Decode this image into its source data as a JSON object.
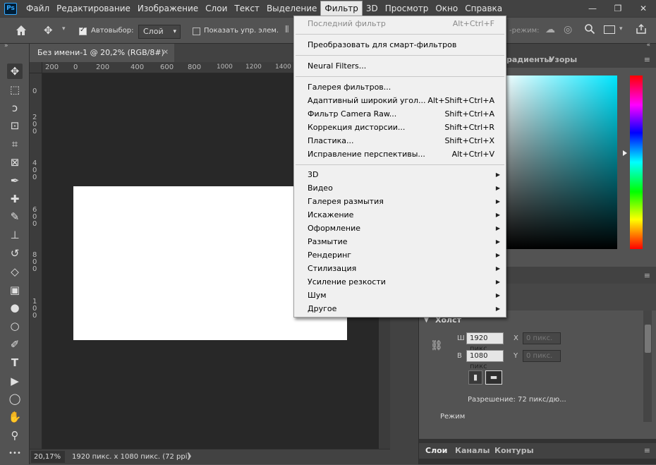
{
  "app": {
    "logo": "Ps"
  },
  "menubar": {
    "items": [
      "Файл",
      "Редактирование",
      "Изображение",
      "Слои",
      "Текст",
      "Выделение",
      "Фильтр",
      "3D",
      "Просмотр",
      "Окно",
      "Справка"
    ],
    "active": "Фильтр"
  },
  "window_buttons": {
    "minimize": "—",
    "restore": "❐",
    "close": "✕"
  },
  "options_bar": {
    "auto_select_label": "Автовыбор:",
    "auto_select_checked": true,
    "auto_select_target": "Слой",
    "show_transform_label": "Показать упр. элем.",
    "show_transform_checked": false,
    "mode_label": "-режим:"
  },
  "document": {
    "tab_title": "Без имени-1 @ 20,2% (RGB/8#)",
    "close_glyph": "✕",
    "zoom": "20,17%",
    "size_info": "1920 пикс. x 1080 пикс. (72 ppi)",
    "status_arrow": "❯",
    "canvas_color": "#ffffff"
  },
  "ruler": {
    "top_labels": [
      "200",
      "0",
      "200",
      "400",
      "600",
      "800",
      "1000",
      "1200",
      "1400"
    ],
    "left_labels": [
      "0",
      "2",
      "0",
      "0",
      "4",
      "0",
      "0",
      "6",
      "0",
      "0",
      "8",
      "0",
      "0",
      "1",
      "0",
      "0"
    ]
  },
  "toolbar": {
    "tools": [
      {
        "name": "move-tool",
        "glyph": "✥",
        "selected": true
      },
      {
        "name": "marquee-tool",
        "glyph": "⬚"
      },
      {
        "name": "lasso-tool",
        "glyph": "ↄ"
      },
      {
        "name": "object-select-tool",
        "glyph": "⊡"
      },
      {
        "name": "crop-tool",
        "glyph": "⌗"
      },
      {
        "name": "frame-tool",
        "glyph": "⊠"
      },
      {
        "name": "eyedropper-tool",
        "glyph": "✒"
      },
      {
        "name": "healing-tool",
        "glyph": "✚"
      },
      {
        "name": "brush-tool",
        "glyph": "✎"
      },
      {
        "name": "stamp-tool",
        "glyph": "⊥"
      },
      {
        "name": "history-brush-tool",
        "glyph": "↺"
      },
      {
        "name": "eraser-tool",
        "glyph": "◇"
      },
      {
        "name": "gradient-tool",
        "glyph": "▣"
      },
      {
        "name": "blur-tool",
        "glyph": "●"
      },
      {
        "name": "dodge-tool",
        "glyph": "○"
      },
      {
        "name": "pen-tool",
        "glyph": "✐"
      },
      {
        "name": "type-tool",
        "glyph": "T"
      },
      {
        "name": "path-select-tool",
        "glyph": "▶"
      },
      {
        "name": "shape-tool",
        "glyph": "◯"
      },
      {
        "name": "hand-tool",
        "glyph": "✋"
      },
      {
        "name": "zoom-tool",
        "glyph": "⚲"
      },
      {
        "name": "more-tools",
        "glyph": "•••"
      }
    ]
  },
  "panels": {
    "color_tabs": [
      "радиенты",
      "Узоры"
    ],
    "properties": {
      "section": "Холст",
      "w_label": "Ш",
      "w_value": "1920 пикс",
      "h_label": "В",
      "h_value": "1080 пикс",
      "x_label": "X",
      "x_value": "0 пикс.",
      "y_label": "Y",
      "y_value": "0 пикс.",
      "resolution": "Разрешение: 72 пикс/дю...",
      "mode_label": "Режим"
    },
    "layers_tabs": [
      "Слои",
      "Каналы",
      "Контуры"
    ]
  },
  "filter_menu": {
    "last_filter": {
      "label": "Последний фильтр",
      "shortcut": "Alt+Ctrl+F",
      "disabled": true
    },
    "smart_filters": {
      "label": "Преобразовать для смарт-фильтров"
    },
    "neural": {
      "label": "Neural Filters..."
    },
    "gallery_items": [
      {
        "label": "Галерея фильтров...",
        "shortcut": ""
      },
      {
        "label": "Адаптивный широкий угол...",
        "shortcut": "Alt+Shift+Ctrl+A"
      },
      {
        "label": "Фильтр Camera Raw...",
        "shortcut": "Shift+Ctrl+A"
      },
      {
        "label": "Коррекция дисторсии...",
        "shortcut": "Shift+Ctrl+R"
      },
      {
        "label": "Пластика...",
        "shortcut": "Shift+Ctrl+X"
      },
      {
        "label": "Исправление перспективы...",
        "shortcut": "Alt+Ctrl+V"
      }
    ],
    "submenus": [
      "3D",
      "Видео",
      "Галерея размытия",
      "Искажение",
      "Оформление",
      "Размытие",
      "Рендеринг",
      "Стилизация",
      "Усиление резкости",
      "Шум",
      "Другое"
    ],
    "submenu_arrow": "▶"
  },
  "colors": {
    "menu_bg": "#f0f0f0",
    "ui_dark": "#424242",
    "ui_mid": "#535353",
    "canvas_bg": "#282828",
    "accent_cyan": "#00e5ff"
  }
}
